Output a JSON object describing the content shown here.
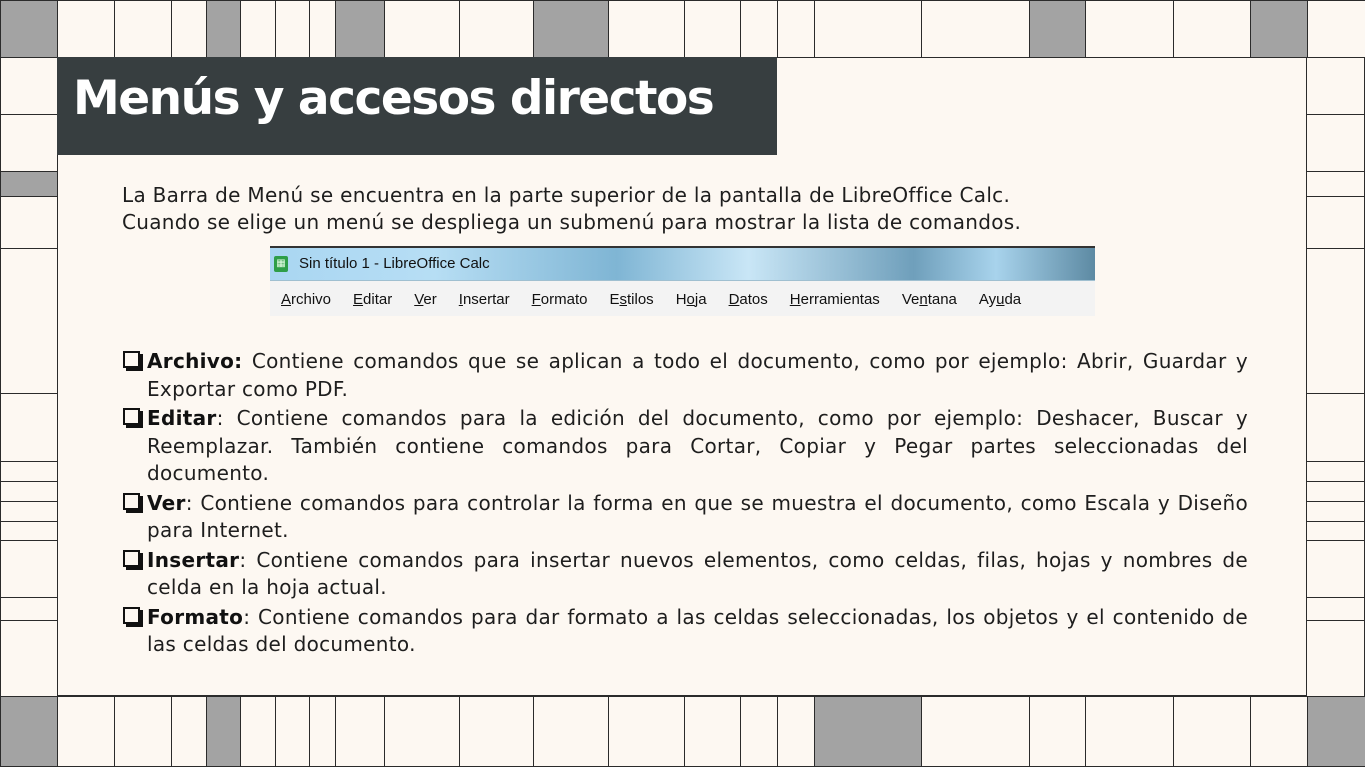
{
  "title": "Menús y accesos directos",
  "intro": [
    "La Barra de Menú se encuentra en la parte superior de la pantalla de LibreOffice Calc.",
    "Cuando se elige un menú se despliega un submenú para mostrar la lista de comandos."
  ],
  "screenshot": {
    "window_title": "Sin título 1 - LibreOffice Calc",
    "app_icon": "spreadsheet-icon",
    "menu": [
      {
        "pre": "",
        "key": "A",
        "post": "rchivo"
      },
      {
        "pre": "",
        "key": "E",
        "post": "ditar"
      },
      {
        "pre": "",
        "key": "V",
        "post": "er"
      },
      {
        "pre": "",
        "key": "I",
        "post": "nsertar"
      },
      {
        "pre": "",
        "key": "F",
        "post": "ormato"
      },
      {
        "pre": "E",
        "key": "s",
        "post": "tilos"
      },
      {
        "pre": "H",
        "key": "o",
        "post": "ja"
      },
      {
        "pre": "",
        "key": "D",
        "post": "atos"
      },
      {
        "pre": "",
        "key": "H",
        "post": "erramientas"
      },
      {
        "pre": "Ve",
        "key": "n",
        "post": "tana"
      },
      {
        "pre": "Ay",
        "key": "u",
        "post": "da"
      }
    ]
  },
  "items": [
    {
      "term": "Archivo:",
      "text": " Contiene comandos que se aplican a todo el documento, como por ejemplo: Abrir, Guardar y Exportar como PDF."
    },
    {
      "term": "Editar",
      "text": ": Contiene comandos para la edición del documento, como por ejemplo: Deshacer, Buscar y Reemplazar. También contiene comandos para Cortar, Copiar y Pegar partes seleccionadas del documento."
    },
    {
      "term": "Ver",
      "text": ": Contiene comandos para controlar la forma en que se muestra el documento, como Escala y Diseño para Internet."
    },
    {
      "term": "Insertar",
      "text": ": Contiene comandos para insertar nuevos elementos, como celdas, filas, hojas y nombres de celda en la hoja actual."
    },
    {
      "term": "Formato",
      "text": ": Contiene comandos para dar formato a las celdas seleccionadas, los objetos y el contenido de las celdas del documento."
    }
  ],
  "colors": {
    "background": "#fdf8f2",
    "title_band": "#373e40",
    "title_text": "#ffffff",
    "grid_gray": "#a3a3a3",
    "body_text": "#1e1e1e"
  }
}
